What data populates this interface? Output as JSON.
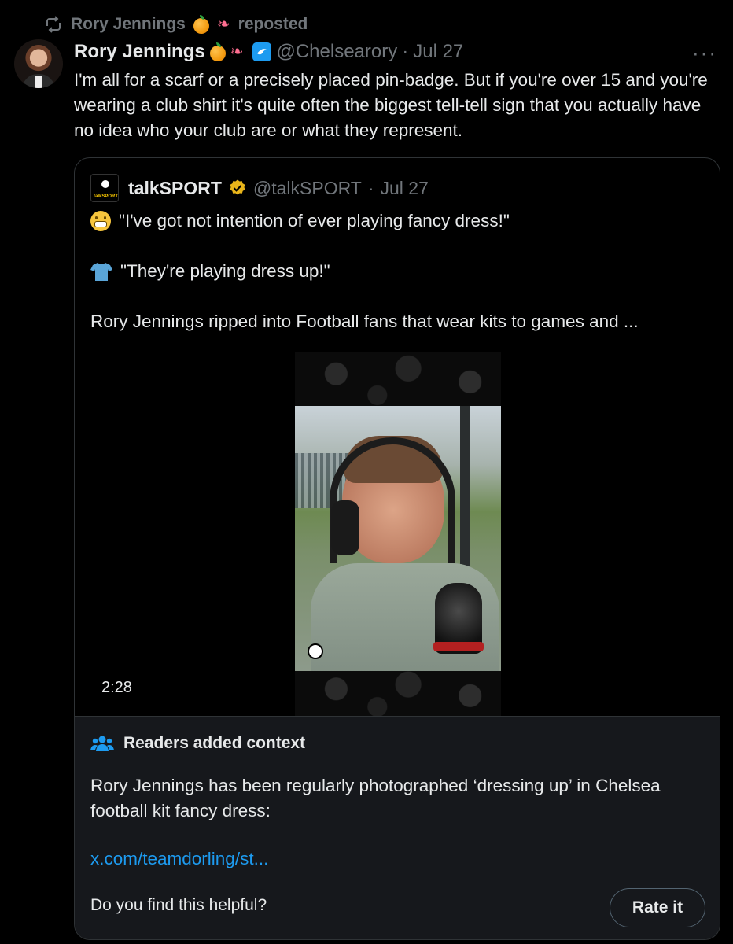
{
  "repost": {
    "label": "Rory Jennings",
    "suffix": "reposted",
    "icon": "repost-icon"
  },
  "tweet": {
    "author_name": "Rory Jennings",
    "handle": "@Chelsearory",
    "separator": "·",
    "date": "Jul 27",
    "more": "···",
    "text": "I'm all for a scarf or a precisely placed pin-badge. But if you're over 15 and you're wearing a club shirt it's quite often the biggest tell-tell sign that you actually have no idea who your club are or what they represent."
  },
  "quote": {
    "author_name": "talkSPORT",
    "handle": "@talkSPORT",
    "separator": "·",
    "date": "Jul 27",
    "line1": "\"I've got not intention of ever playing fancy dress!\"",
    "line2": "\"They're playing dress up!\"",
    "line3": "Rory Jennings ripped into Football fans that wear kits to games and ...",
    "video_duration": "2:28"
  },
  "context": {
    "title": "Readers added context",
    "body": "Rory Jennings has been regularly photographed ‘dressing up’ in Chelsea football kit fancy dress:",
    "link": "x.com/teamdorling/st...",
    "question": "Do you find this helpful?",
    "rate_label": "Rate it"
  },
  "colors": {
    "background": "#000000",
    "text": "#e7e9ea",
    "muted": "#71767b",
    "link": "#1d9bf0",
    "verified_gold": "#e8b41a",
    "context_bg": "#16181c"
  }
}
